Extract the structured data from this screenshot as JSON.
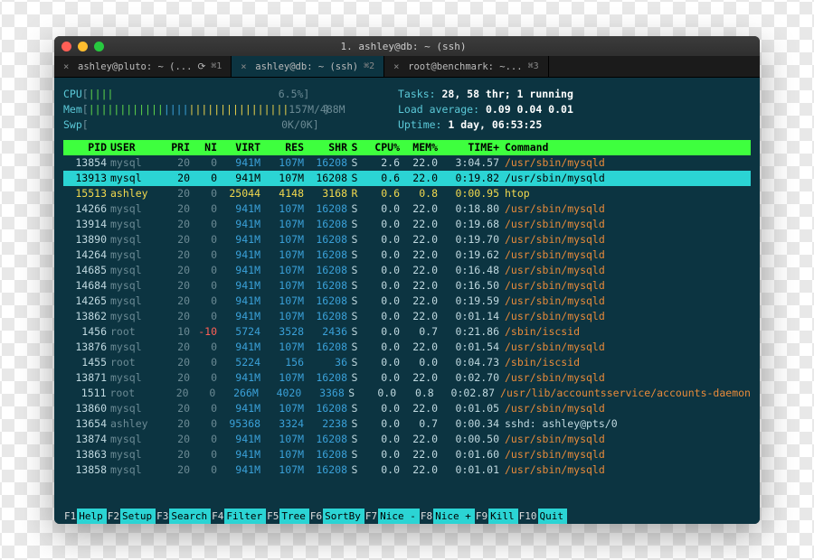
{
  "window": {
    "title": "1. ashley@db: ~ (ssh)"
  },
  "tabs": [
    {
      "label": "ashley@pluto: ~ (...",
      "key": "⌘1",
      "loading": true,
      "active": false
    },
    {
      "label": "ashley@db: ~ (ssh)",
      "key": "⌘2",
      "loading": false,
      "active": true
    },
    {
      "label": "root@benchmark: ~...",
      "key": "⌘3",
      "loading": false,
      "active": false
    }
  ],
  "meters": {
    "cpu": {
      "label": "CPU",
      "bar": "||||",
      "value": "6.5%"
    },
    "mem": {
      "label": "Mem",
      "green": "||||||||||||",
      "blue": "||||",
      "yellow": "||||||||||||||||",
      "value": "157M/488M"
    },
    "swp": {
      "label": "Swp",
      "value": "0K/0K"
    },
    "tasks_label": "Tasks: ",
    "tasks_value": "28, 58 thr; 1 running",
    "load_label": "Load average: ",
    "load_value": "0.09 0.04 0.01",
    "uptime_label": "Uptime: ",
    "uptime_value": "1 day, 06:53:25"
  },
  "columns": {
    "pid": "PID",
    "user": "USER",
    "pri": "PRI",
    "ni": "NI",
    "virt": "VIRT",
    "res": "RES",
    "shr": "SHR",
    "s": "S",
    "cpu": "CPU%",
    "mem": "MEM%",
    "time": "TIME+",
    "cmd": "Command"
  },
  "processes": [
    {
      "pid": "13854",
      "user": "mysql",
      "pri": "20",
      "ni": "0",
      "virt": "941M",
      "res": "107M",
      "shr": "16208",
      "s": "S",
      "cpu": "2.6",
      "mem": "22.0",
      "time": "3:04.57",
      "cmd": "/usr/sbin/mysqld",
      "style": ""
    },
    {
      "pid": "13913",
      "user": "mysql",
      "pri": "20",
      "ni": "0",
      "virt": "941M",
      "res": "107M",
      "shr": "16208",
      "s": "S",
      "cpu": "0.6",
      "mem": "22.0",
      "time": "0:19.82",
      "cmd": "/usr/sbin/mysqld",
      "style": "selected"
    },
    {
      "pid": "15513",
      "user": "ashley",
      "pri": "20",
      "ni": "0",
      "virt": "25044",
      "res": "4148",
      "shr": "3168",
      "s": "R",
      "cpu": "0.6",
      "mem": "0.8",
      "time": "0:00.95",
      "cmd": "htop",
      "style": "yellow-row"
    },
    {
      "pid": "14266",
      "user": "mysql",
      "pri": "20",
      "ni": "0",
      "virt": "941M",
      "res": "107M",
      "shr": "16208",
      "s": "S",
      "cpu": "0.0",
      "mem": "22.0",
      "time": "0:18.80",
      "cmd": "/usr/sbin/mysqld",
      "style": ""
    },
    {
      "pid": "13914",
      "user": "mysql",
      "pri": "20",
      "ni": "0",
      "virt": "941M",
      "res": "107M",
      "shr": "16208",
      "s": "S",
      "cpu": "0.0",
      "mem": "22.0",
      "time": "0:19.68",
      "cmd": "/usr/sbin/mysqld",
      "style": ""
    },
    {
      "pid": "13890",
      "user": "mysql",
      "pri": "20",
      "ni": "0",
      "virt": "941M",
      "res": "107M",
      "shr": "16208",
      "s": "S",
      "cpu": "0.0",
      "mem": "22.0",
      "time": "0:19.70",
      "cmd": "/usr/sbin/mysqld",
      "style": ""
    },
    {
      "pid": "14264",
      "user": "mysql",
      "pri": "20",
      "ni": "0",
      "virt": "941M",
      "res": "107M",
      "shr": "16208",
      "s": "S",
      "cpu": "0.0",
      "mem": "22.0",
      "time": "0:19.62",
      "cmd": "/usr/sbin/mysqld",
      "style": ""
    },
    {
      "pid": "14685",
      "user": "mysql",
      "pri": "20",
      "ni": "0",
      "virt": "941M",
      "res": "107M",
      "shr": "16208",
      "s": "S",
      "cpu": "0.0",
      "mem": "22.0",
      "time": "0:16.48",
      "cmd": "/usr/sbin/mysqld",
      "style": ""
    },
    {
      "pid": "14684",
      "user": "mysql",
      "pri": "20",
      "ni": "0",
      "virt": "941M",
      "res": "107M",
      "shr": "16208",
      "s": "S",
      "cpu": "0.0",
      "mem": "22.0",
      "time": "0:16.50",
      "cmd": "/usr/sbin/mysqld",
      "style": ""
    },
    {
      "pid": "14265",
      "user": "mysql",
      "pri": "20",
      "ni": "0",
      "virt": "941M",
      "res": "107M",
      "shr": "16208",
      "s": "S",
      "cpu": "0.0",
      "mem": "22.0",
      "time": "0:19.59",
      "cmd": "/usr/sbin/mysqld",
      "style": ""
    },
    {
      "pid": "13862",
      "user": "mysql",
      "pri": "20",
      "ni": "0",
      "virt": "941M",
      "res": "107M",
      "shr": "16208",
      "s": "S",
      "cpu": "0.0",
      "mem": "22.0",
      "time": "0:01.14",
      "cmd": "/usr/sbin/mysqld",
      "style": ""
    },
    {
      "pid": "1456",
      "user": "root",
      "pri": "10",
      "ni": "-10",
      "virt": "5724",
      "res": "3528",
      "shr": "2436",
      "s": "S",
      "cpu": "0.0",
      "mem": "0.7",
      "time": "0:21.86",
      "cmd": "/sbin/iscsid",
      "style": "",
      "ni_red": true
    },
    {
      "pid": "13876",
      "user": "mysql",
      "pri": "20",
      "ni": "0",
      "virt": "941M",
      "res": "107M",
      "shr": "16208",
      "s": "S",
      "cpu": "0.0",
      "mem": "22.0",
      "time": "0:01.54",
      "cmd": "/usr/sbin/mysqld",
      "style": ""
    },
    {
      "pid": "1455",
      "user": "root",
      "pri": "20",
      "ni": "0",
      "virt": "5224",
      "res": "156",
      "shr": "36",
      "s": "S",
      "cpu": "0.0",
      "mem": "0.0",
      "time": "0:04.73",
      "cmd": "/sbin/iscsid",
      "style": ""
    },
    {
      "pid": "13871",
      "user": "mysql",
      "pri": "20",
      "ni": "0",
      "virt": "941M",
      "res": "107M",
      "shr": "16208",
      "s": "S",
      "cpu": "0.0",
      "mem": "22.0",
      "time": "0:02.70",
      "cmd": "/usr/sbin/mysqld",
      "style": ""
    },
    {
      "pid": "1511",
      "user": "root",
      "pri": "20",
      "ni": "0",
      "virt": "266M",
      "res": "4020",
      "shr": "3368",
      "s": "S",
      "cpu": "0.0",
      "mem": "0.8",
      "time": "0:02.87",
      "cmd": "/usr/lib/accountsservice/accounts-daemon",
      "style": ""
    },
    {
      "pid": "13860",
      "user": "mysql",
      "pri": "20",
      "ni": "0",
      "virt": "941M",
      "res": "107M",
      "shr": "16208",
      "s": "S",
      "cpu": "0.0",
      "mem": "22.0",
      "time": "0:01.05",
      "cmd": "/usr/sbin/mysqld",
      "style": ""
    },
    {
      "pid": "13654",
      "user": "ashley",
      "pri": "20",
      "ni": "0",
      "virt": "95368",
      "res": "3324",
      "shr": "2238",
      "s": "S",
      "cpu": "0.0",
      "mem": "0.7",
      "time": "0:00.34",
      "cmd": "sshd: ashley@pts/0",
      "style": "",
      "plain_cmd": true
    },
    {
      "pid": "13874",
      "user": "mysql",
      "pri": "20",
      "ni": "0",
      "virt": "941M",
      "res": "107M",
      "shr": "16208",
      "s": "S",
      "cpu": "0.0",
      "mem": "22.0",
      "time": "0:00.50",
      "cmd": "/usr/sbin/mysqld",
      "style": ""
    },
    {
      "pid": "13863",
      "user": "mysql",
      "pri": "20",
      "ni": "0",
      "virt": "941M",
      "res": "107M",
      "shr": "16208",
      "s": "S",
      "cpu": "0.0",
      "mem": "22.0",
      "time": "0:01.60",
      "cmd": "/usr/sbin/mysqld",
      "style": ""
    },
    {
      "pid": "13858",
      "user": "mysql",
      "pri": "20",
      "ni": "0",
      "virt": "941M",
      "res": "107M",
      "shr": "16208",
      "s": "S",
      "cpu": "0.0",
      "mem": "22.0",
      "time": "0:01.01",
      "cmd": "/usr/sbin/mysqld",
      "style": ""
    }
  ],
  "footer": [
    {
      "key": "F1",
      "label": "Help"
    },
    {
      "key": "F2",
      "label": "Setup"
    },
    {
      "key": "F3",
      "label": "Search"
    },
    {
      "key": "F4",
      "label": "Filter"
    },
    {
      "key": "F5",
      "label": "Tree"
    },
    {
      "key": "F6",
      "label": "SortBy"
    },
    {
      "key": "F7",
      "label": "Nice -"
    },
    {
      "key": "F8",
      "label": "Nice +"
    },
    {
      "key": "F9",
      "label": "Kill"
    },
    {
      "key": "F10",
      "label": "Quit"
    }
  ]
}
